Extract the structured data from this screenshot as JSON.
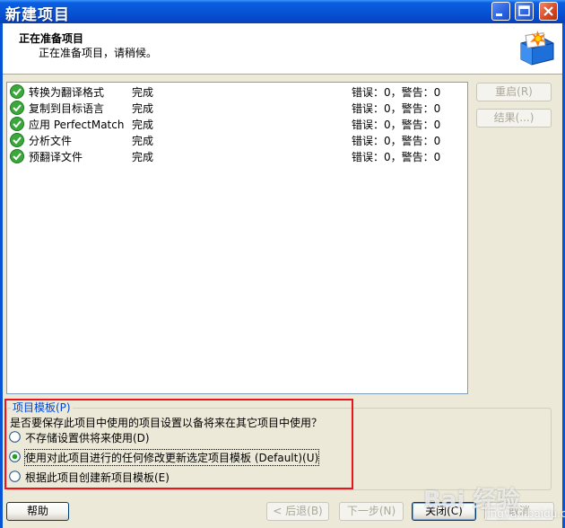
{
  "window": {
    "title": "新建项目"
  },
  "header": {
    "title": "正在准备项目",
    "subtitle": "正在准备项目，请稍候。"
  },
  "tasks": [
    {
      "name": "转换为翻译格式",
      "status": "完成",
      "result": "错误：0，警告：0"
    },
    {
      "name": "复制到目标语言",
      "status": "完成",
      "result": "错误：0，警告：0"
    },
    {
      "name": "应用 PerfectMatch",
      "status": "完成",
      "result": "错误：0，警告：0"
    },
    {
      "name": "分析文件",
      "status": "完成",
      "result": "错误：0，警告：0"
    },
    {
      "name": "预翻译文件",
      "status": "完成",
      "result": "错误：0，警告：0"
    }
  ],
  "side_buttons": {
    "restart_label": "重启(R)",
    "results_label": "结果(...)"
  },
  "template_group": {
    "legend": "项目模板(P)",
    "question": "是否要保存此项目中使用的项目设置以备将来在其它项目中使用？",
    "options": [
      {
        "label": "不存储设置供将来使用(D)",
        "selected": false
      },
      {
        "label": "使用对此项目进行的任何修改更新选定项目模板 (Default)(U)",
        "selected": true
      },
      {
        "label": "根据此项目创建新项目模板(E)",
        "selected": false
      }
    ]
  },
  "footer": {
    "help_label": "帮助",
    "back_label": "< 后退(B)",
    "next_label": "下一步(N)",
    "close_label": "关闭(C)",
    "cancel_label": "取消"
  },
  "watermark": {
    "text": "Bai 经验",
    "sub": "jingyan.baidu.com"
  },
  "colors": {
    "titlebar": "#0754d6",
    "highlight": "#e8141e",
    "dialog_bg": "#ece9d8"
  }
}
